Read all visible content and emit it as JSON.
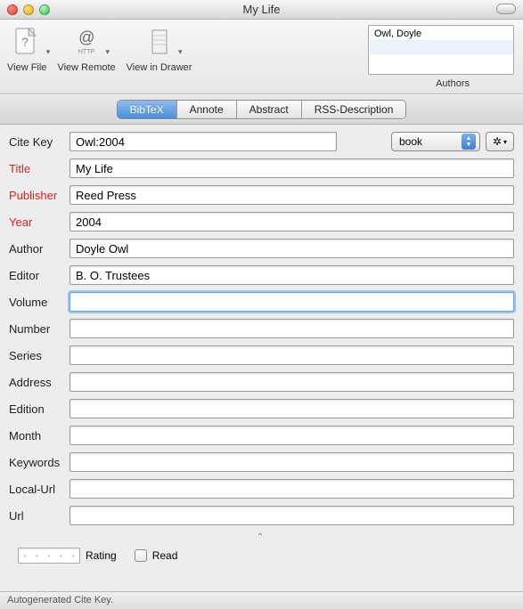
{
  "window": {
    "title": "My Life"
  },
  "toolbar": {
    "view_file": "View File",
    "view_remote": "View Remote",
    "view_in_drawer": "View in Drawer",
    "authors_label": "Authors"
  },
  "authors_list": [
    "Owl, Doyle"
  ],
  "tabs": {
    "bibtex": "BibTeX",
    "annote": "Annote",
    "abstract": "Abstract",
    "rss": "RSS-Description"
  },
  "citekey": {
    "label": "Cite Key",
    "value": "Owl:2004"
  },
  "type_select": {
    "value": "book"
  },
  "fields": {
    "title": {
      "label": "Title",
      "value": "My Life",
      "required": true
    },
    "publisher": {
      "label": "Publisher",
      "value": "Reed Press",
      "required": true
    },
    "year": {
      "label": "Year",
      "value": "2004",
      "required": true
    },
    "author": {
      "label": "Author",
      "value": "Doyle Owl",
      "required": false
    },
    "editor": {
      "label": "Editor",
      "value": "B. O. Trustees",
      "required": false
    },
    "volume": {
      "label": "Volume",
      "value": "",
      "required": false,
      "focused": true
    },
    "number": {
      "label": "Number",
      "value": "",
      "required": false
    },
    "series": {
      "label": "Series",
      "value": "",
      "required": false
    },
    "address": {
      "label": "Address",
      "value": "",
      "required": false
    },
    "edition": {
      "label": "Edition",
      "value": "",
      "required": false
    },
    "month": {
      "label": "Month",
      "value": "",
      "required": false
    },
    "keywords": {
      "label": "Keywords",
      "value": "",
      "required": false
    },
    "localurl": {
      "label": "Local-Url",
      "value": "",
      "required": false
    },
    "url": {
      "label": "Url",
      "value": "",
      "required": false
    }
  },
  "rating": {
    "label": "Rating"
  },
  "read": {
    "label": "Read"
  },
  "status": "Autogenerated Cite Key."
}
